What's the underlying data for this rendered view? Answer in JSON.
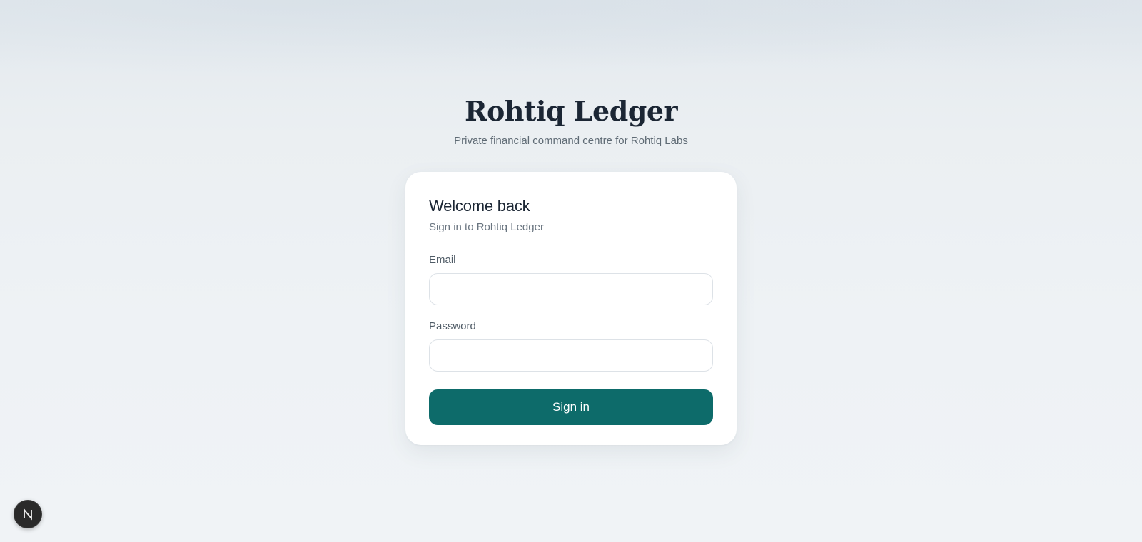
{
  "brand": {
    "title": "Rohtiq Ledger",
    "subtitle": "Private financial command centre for Rohtiq Labs"
  },
  "login_card": {
    "heading": "Welcome back",
    "subheading": "Sign in to Rohtiq Ledger",
    "email": {
      "label": "Email",
      "value": "",
      "placeholder": ""
    },
    "password": {
      "label": "Password",
      "value": "",
      "placeholder": ""
    },
    "submit_label": "Sign in"
  },
  "dev_indicator": {
    "icon": "nextjs-logo-icon",
    "letter": "N"
  },
  "colors": {
    "accent": "#0d6b6a",
    "title_text": "#1b2634",
    "muted_text": "#5f6b75",
    "badge_bg": "#2a2a2a"
  }
}
